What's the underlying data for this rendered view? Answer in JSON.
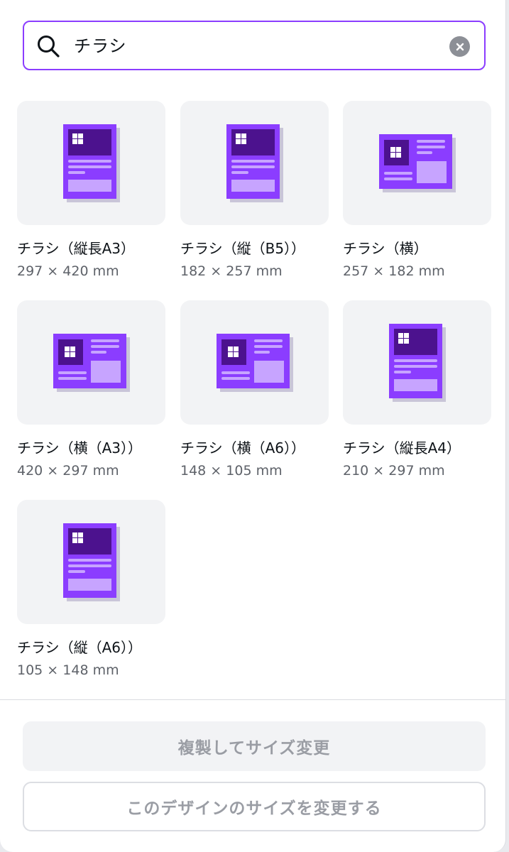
{
  "search": {
    "value": "チラシ"
  },
  "results": [
    {
      "name": "チラシ（縦長A3）",
      "dims": "297 × 420 mm",
      "orientation": "portrait"
    },
    {
      "name": "チラシ（縦（B5））",
      "dims": "182 × 257 mm",
      "orientation": "portrait"
    },
    {
      "name": "チラシ（横）",
      "dims": "257 × 182 mm",
      "orientation": "landscape"
    },
    {
      "name": "チラシ（横（A3））",
      "dims": "420 × 297 mm",
      "orientation": "landscape"
    },
    {
      "name": "チラシ（横（A6））",
      "dims": "148 × 105 mm",
      "orientation": "landscape"
    },
    {
      "name": "チラシ（縦長A4）",
      "dims": "210 × 297 mm",
      "orientation": "portrait"
    },
    {
      "name": "チラシ（縦（A6））",
      "dims": "105 × 148 mm",
      "orientation": "portrait"
    }
  ],
  "footer": {
    "copy_resize_label": "複製してサイズ変更",
    "resize_this_label": "このデザインのサイズを変更する"
  },
  "colors": {
    "accent": "#8b3dff",
    "flyer_body": "#8b3dff",
    "flyer_dark": "#4c128e",
    "flyer_light": "#c7a4ff",
    "tile_bg": "#f2f3f5"
  },
  "icons": {
    "search": "search-icon",
    "clear": "clear-icon",
    "thumbnail": "flyer-template-icon"
  }
}
